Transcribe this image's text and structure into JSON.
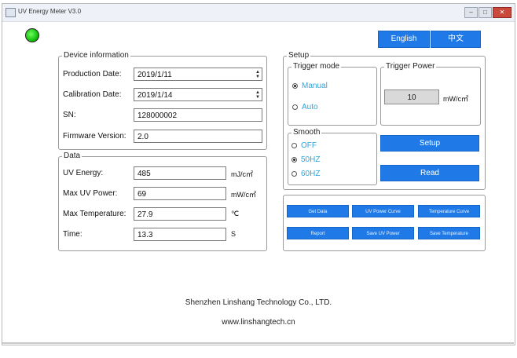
{
  "window": {
    "title": "UV Energy Meter V3.0",
    "minimize": "–",
    "restore": "□",
    "close": "✕"
  },
  "language": {
    "english": "English",
    "chinese": "中文"
  },
  "device_info": {
    "legend": "Device information",
    "production_date": {
      "label": "Production Date:",
      "value": "2019/1/11"
    },
    "calibration_date": {
      "label": "Calibration Date:",
      "value": "2019/1/14"
    },
    "sn": {
      "label": "SN:",
      "value": "128000002"
    },
    "firmware": {
      "label": "Firmware Version:",
      "value": "2.0"
    }
  },
  "data": {
    "legend": "Data",
    "uv_energy": {
      "label": "UV Energy:",
      "value": "485",
      "unit": "mJ/c㎡"
    },
    "max_uv_power": {
      "label": "Max UV Power:",
      "value": "69",
      "unit": "mW/c㎡"
    },
    "max_temperature": {
      "label": "Max Temperature:",
      "value": "27.9",
      "unit": "℃"
    },
    "time": {
      "label": "Time:",
      "value": "13.3",
      "unit": "S"
    }
  },
  "setup": {
    "legend": "Setup",
    "trigger_mode": {
      "legend": "Trigger mode",
      "manual": "Manual",
      "auto": "Auto",
      "selected": "Manual"
    },
    "trigger_power": {
      "legend": "Trigger Power",
      "value": "10",
      "unit": "mW/c㎡"
    },
    "smooth": {
      "legend": "Smooth",
      "off": "OFF",
      "hz50": "50HZ",
      "hz60": "60HZ",
      "selected": "50HZ"
    },
    "setup_button": "Setup",
    "read_button": "Read"
  },
  "actions": {
    "get_data": "Get Data",
    "uv_power_curve": "UV Power Curve",
    "temperature_curve": "Temperature Curve",
    "report": "Report",
    "save_uv_power": "Save UV Power",
    "save_temperature": "Save Temperature"
  },
  "footer": {
    "company": "Shenzhen Linshang Technology Co., LTD.",
    "website": "www.linshangtech.cn"
  },
  "colors": {
    "accent": "#1f7ae8",
    "radio_text": "#2fa3d8",
    "led": "#16c10f"
  }
}
